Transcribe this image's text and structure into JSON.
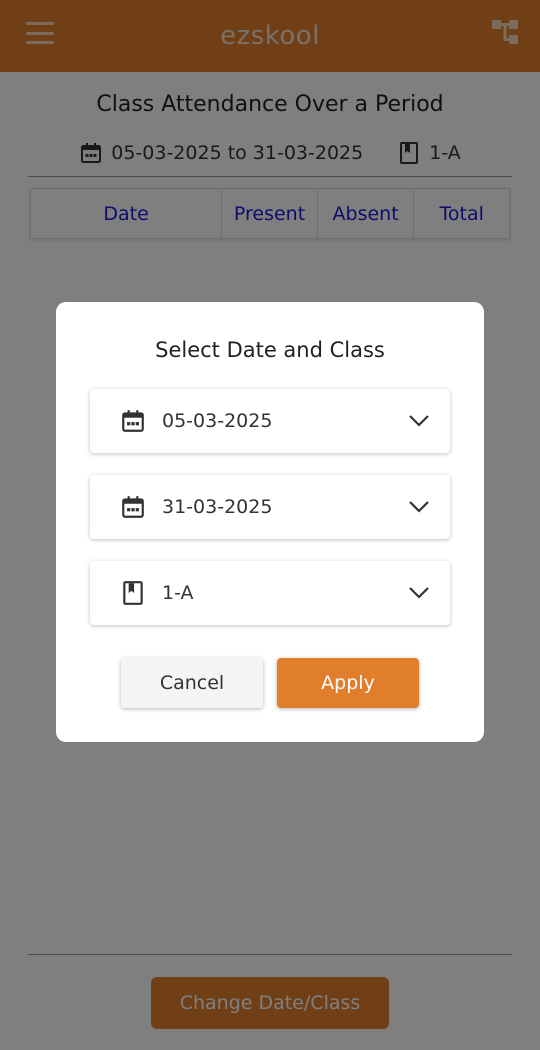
{
  "app_bar": {
    "title": "ezskool",
    "accent_color": "#e07e2c",
    "menu_icon": "hamburger-menu-icon",
    "tree_icon": "org-tree-icon"
  },
  "page": {
    "title": "Class Attendance Over a Period",
    "date_range": "05-03-2025 to 31-03-2025",
    "class_name": "1-A",
    "table_headers": [
      "Date",
      "Present",
      "Absent",
      "Total"
    ],
    "change_button": "Change Date/Class"
  },
  "dialog": {
    "title": "Select Date and Class",
    "start_date": "05-03-2025",
    "end_date": "31-03-2025",
    "class_value": "1-A",
    "cancel_label": "Cancel",
    "apply_label": "Apply"
  }
}
